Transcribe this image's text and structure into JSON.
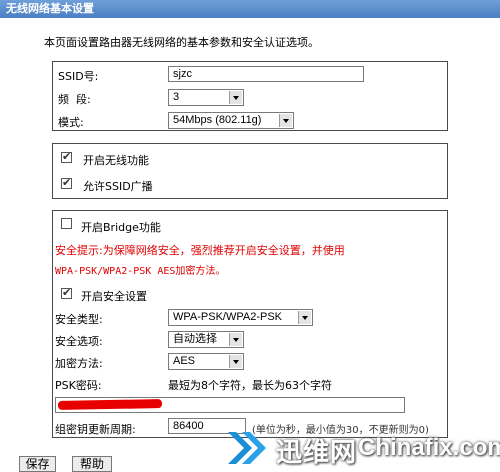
{
  "title": "无线网络基本设置",
  "intro": "本页面设置路由器无线网络的基本参数和安全认证选项。",
  "basic": {
    "ssid_label": "SSID号:",
    "ssid_value": "sjzc",
    "channel_label": "频  段:",
    "channel_value": "3",
    "mode_label": "模式:",
    "mode_value": "54Mbps (802.11g)"
  },
  "wireless": {
    "enable_label": "开启无线功能",
    "enable_checked": true,
    "broadcast_label": "允许SSID广播",
    "broadcast_checked": true
  },
  "security": {
    "bridge_label": "开启Bridge功能",
    "bridge_checked": false,
    "tip_line1": "安全提示:为保障网络安全，强烈推荐开启安全设置，并使用",
    "tip_line2": "WPA-PSK/WPA2-PSK AES加密方法。",
    "enable_security_label": "开启安全设置",
    "enable_security_checked": true,
    "type_label": "安全类型:",
    "type_value": "WPA-PSK/WPA2-PSK",
    "option_label": "安全选项:",
    "option_value": "自动选择",
    "cipher_label": "加密方法:",
    "cipher_value": "AES",
    "psk_label": "PSK密码:",
    "psk_hint": "最短为8个字符，最长为63个字符",
    "renew_label": "组密钥更新周期:",
    "renew_value": "86400",
    "renew_hint": "(单位为秒，最小值为30，不更新则为0)"
  },
  "buttons": {
    "save": "保存",
    "help": "帮助"
  },
  "watermark": {
    "cn": "迅维网",
    "en": "Chinafix.com"
  },
  "colors": {
    "title_bar": "#4a7fc4",
    "warning": "#e00000",
    "border": "#4a4a4a"
  }
}
